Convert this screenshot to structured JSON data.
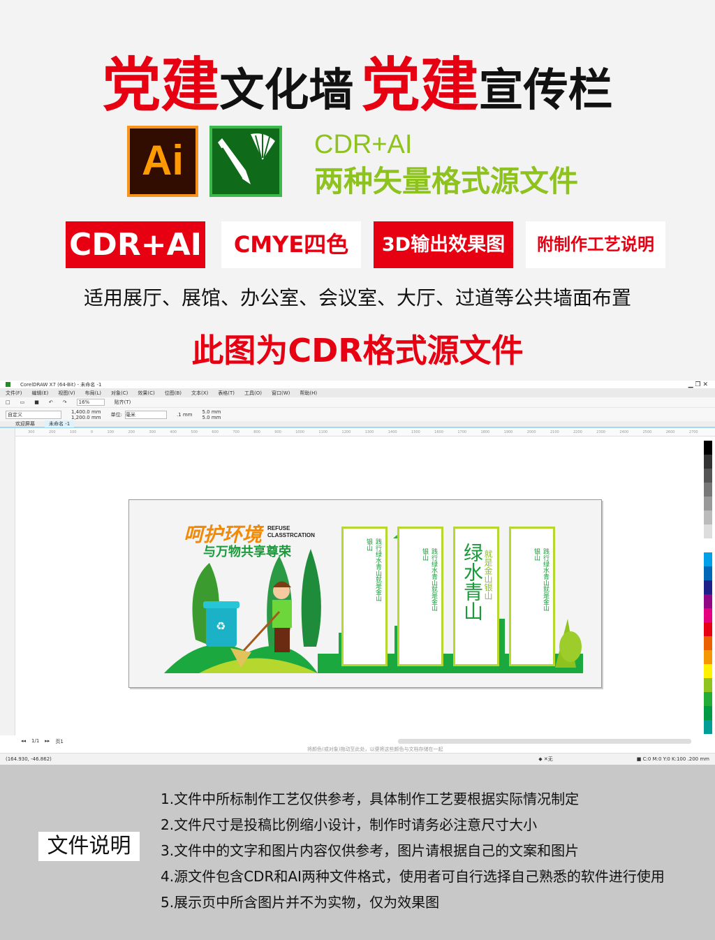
{
  "header": {
    "title_red_1": "党建",
    "title_black_1": "文化墙",
    "title_red_2": "党建",
    "title_black_2": "宣传栏"
  },
  "formats": {
    "ai_icon_label": "Ai",
    "line1": "CDR+AI",
    "line2": "两种矢量格式源文件"
  },
  "badges": [
    {
      "label": "CDR+AI"
    },
    {
      "label": "CMYE四色"
    },
    {
      "label": "3D输出效果图"
    },
    {
      "label": "附制作工艺说明"
    }
  ],
  "usage": "适用展厅、展馆、办公室、会议室、大厅、过道等公共墙面布置",
  "notice": "此图为CDR格式源文件",
  "app": {
    "title": "CorelDRAW X7 (64-Bit) - 未命名 -1",
    "menu": [
      "文件(F)",
      "编辑(E)",
      "视图(V)",
      "布局(L)",
      "对象(C)",
      "效果(C)",
      "位图(B)",
      "文本(X)",
      "表格(T)",
      "工具(O)",
      "窗口(W)",
      "帮助(H)"
    ],
    "zoom": "16%",
    "snap": "贴齐(T)",
    "preset": "自定义",
    "width": "1,400.0 mm",
    "height": "1,200.0 mm",
    "unit_label": "单位:",
    "unit": "毫米",
    "nudge": ".1 mm",
    "dup_x": "5.0 mm",
    "dup_y": "5.0 mm",
    "tabs": [
      "欢迎屏幕",
      "未命名 -1"
    ],
    "ruler": [
      "300",
      "200",
      "100",
      "0",
      "100",
      "200",
      "300",
      "400",
      "500",
      "600",
      "700",
      "800",
      "900",
      "1000",
      "1100",
      "1200",
      "1300",
      "1400",
      "1500",
      "1600",
      "1700",
      "1800",
      "1900",
      "2000",
      "2100",
      "2200",
      "2300",
      "2400",
      "2500",
      "2600",
      "2700"
    ],
    "page_nav": "1/1",
    "page_tab": "页1",
    "hint": "将颜色(或对象)拖动至此处，以便将这些颜色与文档存储在一起",
    "coords": "(164.930, -46.862)",
    "fill_none": "无",
    "outline": "C:0 M:0 Y:0 K:100  .200 mm",
    "palette": [
      "#000",
      "#333",
      "#555",
      "#777",
      "#999",
      "#bbb",
      "#ddd",
      "#fff",
      "#00a0e9",
      "#0068b7",
      "#1d2088",
      "#920783",
      "#e4007f",
      "#e60012",
      "#eb6100",
      "#f39800",
      "#fff100",
      "#8fc31f",
      "#22ac38",
      "#009944",
      "#009e96"
    ]
  },
  "artwork": {
    "title_cn": "呵护环境",
    "title_en_1": "REFUSE",
    "title_en_2": "CLASSTRCATION",
    "subtitle": "与万物共享尊荣",
    "panel_text": "践行绿水青山就是金山银山",
    "calligraphy": "绿水青山",
    "slogan": "就是金山银山"
  },
  "footer": {
    "label": "文件说明",
    "notes": [
      "1.文件中所标制作工艺仅供参考，具体制作工艺要根据实际情况制定",
      "2.文件尺寸是投稿比例缩小设计，制作时请务必注意尺寸大小",
      "3.文件中的文字和图片内容仅供参考，图片请根据自己的文案和图片",
      "4.源文件包含CDR和AI两种文件格式，使用者可自行选择自己熟悉的软件进行使用",
      "5.展示页中所含图片并不为实物，仅为效果图"
    ]
  }
}
